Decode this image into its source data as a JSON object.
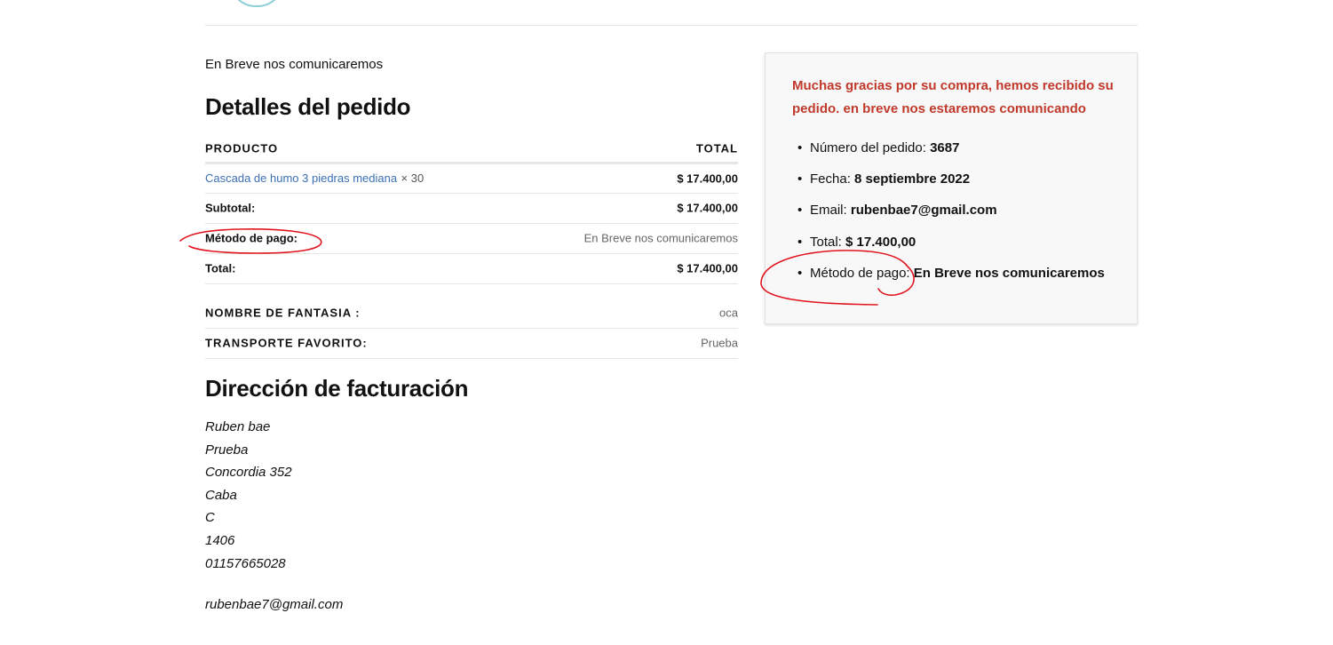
{
  "intro_text": "En Breve nos comunicaremos",
  "order_details": {
    "title": "Detalles del pedido",
    "headers": {
      "product": "PRODUCTO",
      "total": "TOTAL"
    },
    "item": {
      "name": "Cascada de humo 3 piedras mediana",
      "qty": "× 30",
      "total": "$ 17.400,00"
    },
    "subtotal": {
      "label": "Subtotal:",
      "value": "$ 17.400,00"
    },
    "payment": {
      "label": "Método de pago:",
      "value": "En Breve nos comunicaremos"
    },
    "total": {
      "label": "Total:",
      "value": "$ 17.400,00"
    },
    "extra": [
      {
        "label": "NOMBRE DE FANTASIA :",
        "value": "oca"
      },
      {
        "label": "TRANSPORTE FAVORITO:",
        "value": "Prueba"
      }
    ]
  },
  "billing": {
    "title": "Dirección de facturación",
    "lines": [
      "Ruben bae",
      "Prueba",
      "Concordia 352",
      "Caba",
      "C",
      "1406",
      "01157665028"
    ],
    "email": "rubenbae7@gmail.com"
  },
  "overview": {
    "message": "Muchas gracias por su compra, hemos recibido su pedido. en breve nos estaremos comunicando",
    "items": [
      {
        "label": "Número del pedido:",
        "value": "3687"
      },
      {
        "label": "Fecha:",
        "value": "8 septiembre 2022"
      },
      {
        "label": "Email:",
        "value": "rubenbae7@gmail.com"
      },
      {
        "label": "Total:",
        "value": "$ 17.400,00"
      },
      {
        "label": "Método de pago:",
        "value": "En Breve nos comunicaremos"
      }
    ]
  },
  "colors": {
    "link": "#3b6fb6",
    "thanks": "#c0392b",
    "annotation": "#e0141e"
  }
}
